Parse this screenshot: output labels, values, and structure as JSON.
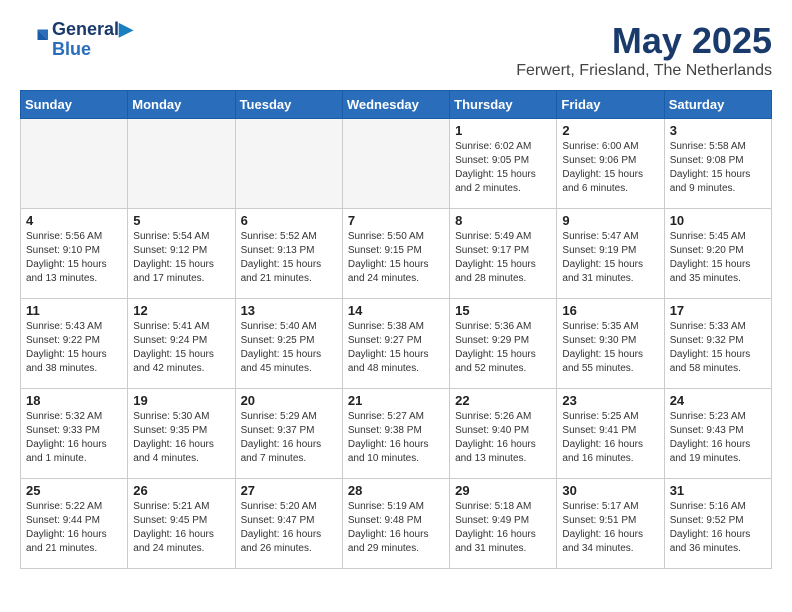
{
  "header": {
    "logo_line1": "General",
    "logo_line2": "Blue",
    "month": "May 2025",
    "location": "Ferwert, Friesland, The Netherlands"
  },
  "weekdays": [
    "Sunday",
    "Monday",
    "Tuesday",
    "Wednesday",
    "Thursday",
    "Friday",
    "Saturday"
  ],
  "weeks": [
    [
      {
        "day": "",
        "info": ""
      },
      {
        "day": "",
        "info": ""
      },
      {
        "day": "",
        "info": ""
      },
      {
        "day": "",
        "info": ""
      },
      {
        "day": "1",
        "info": "Sunrise: 6:02 AM\nSunset: 9:05 PM\nDaylight: 15 hours\nand 2 minutes."
      },
      {
        "day": "2",
        "info": "Sunrise: 6:00 AM\nSunset: 9:06 PM\nDaylight: 15 hours\nand 6 minutes."
      },
      {
        "day": "3",
        "info": "Sunrise: 5:58 AM\nSunset: 9:08 PM\nDaylight: 15 hours\nand 9 minutes."
      }
    ],
    [
      {
        "day": "4",
        "info": "Sunrise: 5:56 AM\nSunset: 9:10 PM\nDaylight: 15 hours\nand 13 minutes."
      },
      {
        "day": "5",
        "info": "Sunrise: 5:54 AM\nSunset: 9:12 PM\nDaylight: 15 hours\nand 17 minutes."
      },
      {
        "day": "6",
        "info": "Sunrise: 5:52 AM\nSunset: 9:13 PM\nDaylight: 15 hours\nand 21 minutes."
      },
      {
        "day": "7",
        "info": "Sunrise: 5:50 AM\nSunset: 9:15 PM\nDaylight: 15 hours\nand 24 minutes."
      },
      {
        "day": "8",
        "info": "Sunrise: 5:49 AM\nSunset: 9:17 PM\nDaylight: 15 hours\nand 28 minutes."
      },
      {
        "day": "9",
        "info": "Sunrise: 5:47 AM\nSunset: 9:19 PM\nDaylight: 15 hours\nand 31 minutes."
      },
      {
        "day": "10",
        "info": "Sunrise: 5:45 AM\nSunset: 9:20 PM\nDaylight: 15 hours\nand 35 minutes."
      }
    ],
    [
      {
        "day": "11",
        "info": "Sunrise: 5:43 AM\nSunset: 9:22 PM\nDaylight: 15 hours\nand 38 minutes."
      },
      {
        "day": "12",
        "info": "Sunrise: 5:41 AM\nSunset: 9:24 PM\nDaylight: 15 hours\nand 42 minutes."
      },
      {
        "day": "13",
        "info": "Sunrise: 5:40 AM\nSunset: 9:25 PM\nDaylight: 15 hours\nand 45 minutes."
      },
      {
        "day": "14",
        "info": "Sunrise: 5:38 AM\nSunset: 9:27 PM\nDaylight: 15 hours\nand 48 minutes."
      },
      {
        "day": "15",
        "info": "Sunrise: 5:36 AM\nSunset: 9:29 PM\nDaylight: 15 hours\nand 52 minutes."
      },
      {
        "day": "16",
        "info": "Sunrise: 5:35 AM\nSunset: 9:30 PM\nDaylight: 15 hours\nand 55 minutes."
      },
      {
        "day": "17",
        "info": "Sunrise: 5:33 AM\nSunset: 9:32 PM\nDaylight: 15 hours\nand 58 minutes."
      }
    ],
    [
      {
        "day": "18",
        "info": "Sunrise: 5:32 AM\nSunset: 9:33 PM\nDaylight: 16 hours\nand 1 minute."
      },
      {
        "day": "19",
        "info": "Sunrise: 5:30 AM\nSunset: 9:35 PM\nDaylight: 16 hours\nand 4 minutes."
      },
      {
        "day": "20",
        "info": "Sunrise: 5:29 AM\nSunset: 9:37 PM\nDaylight: 16 hours\nand 7 minutes."
      },
      {
        "day": "21",
        "info": "Sunrise: 5:27 AM\nSunset: 9:38 PM\nDaylight: 16 hours\nand 10 minutes."
      },
      {
        "day": "22",
        "info": "Sunrise: 5:26 AM\nSunset: 9:40 PM\nDaylight: 16 hours\nand 13 minutes."
      },
      {
        "day": "23",
        "info": "Sunrise: 5:25 AM\nSunset: 9:41 PM\nDaylight: 16 hours\nand 16 minutes."
      },
      {
        "day": "24",
        "info": "Sunrise: 5:23 AM\nSunset: 9:43 PM\nDaylight: 16 hours\nand 19 minutes."
      }
    ],
    [
      {
        "day": "25",
        "info": "Sunrise: 5:22 AM\nSunset: 9:44 PM\nDaylight: 16 hours\nand 21 minutes."
      },
      {
        "day": "26",
        "info": "Sunrise: 5:21 AM\nSunset: 9:45 PM\nDaylight: 16 hours\nand 24 minutes."
      },
      {
        "day": "27",
        "info": "Sunrise: 5:20 AM\nSunset: 9:47 PM\nDaylight: 16 hours\nand 26 minutes."
      },
      {
        "day": "28",
        "info": "Sunrise: 5:19 AM\nSunset: 9:48 PM\nDaylight: 16 hours\nand 29 minutes."
      },
      {
        "day": "29",
        "info": "Sunrise: 5:18 AM\nSunset: 9:49 PM\nDaylight: 16 hours\nand 31 minutes."
      },
      {
        "day": "30",
        "info": "Sunrise: 5:17 AM\nSunset: 9:51 PM\nDaylight: 16 hours\nand 34 minutes."
      },
      {
        "day": "31",
        "info": "Sunrise: 5:16 AM\nSunset: 9:52 PM\nDaylight: 16 hours\nand 36 minutes."
      }
    ]
  ]
}
